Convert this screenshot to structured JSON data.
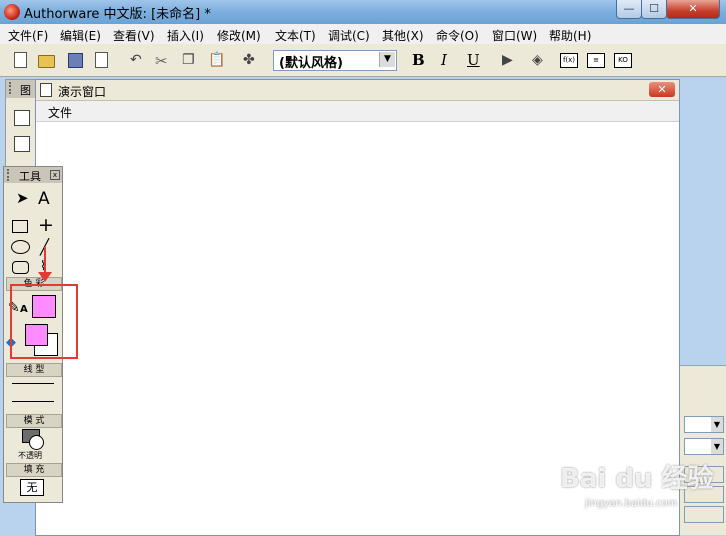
{
  "window": {
    "title": "Authorware 中文版: [未命名] *"
  },
  "title_buttons": {
    "minimize": "—",
    "maximize": "☐",
    "close": "✕"
  },
  "menu": [
    "文件(F)",
    "编辑(E)",
    "查看(V)",
    "插入(I)",
    "修改(M)",
    "文本(T)",
    "调试(C)",
    "其他(X)",
    "命令(O)",
    "窗口(W)",
    "帮助(H)"
  ],
  "toolbar": {
    "style_select": "(默认风格)",
    "bold": "B",
    "italic": "I",
    "underline": "U",
    "fn_label": "f(x)",
    "ko_label": "KO"
  },
  "demo_window": {
    "title": "演示窗口",
    "menu_file": "文件",
    "close": "✕"
  },
  "icon_palette": {
    "title": "图"
  },
  "tools": {
    "title": "工具",
    "close": "x",
    "text_tool": "A",
    "cross_tool": "+",
    "color_label": "色 彩",
    "line_type_label": "线 型",
    "mode_label": "模 式",
    "mode_value": "不透明",
    "fill_label": "填 充",
    "fill_value": "无",
    "pen_text": "A"
  },
  "colors": {
    "pen_color": "#ff8cff",
    "fill_color": "#ff8cff",
    "bg_color": "#ffffff",
    "annotation": "#e53935"
  },
  "watermark": {
    "main": "Bai du 经验",
    "sub": "jingyan.baidu.com"
  }
}
